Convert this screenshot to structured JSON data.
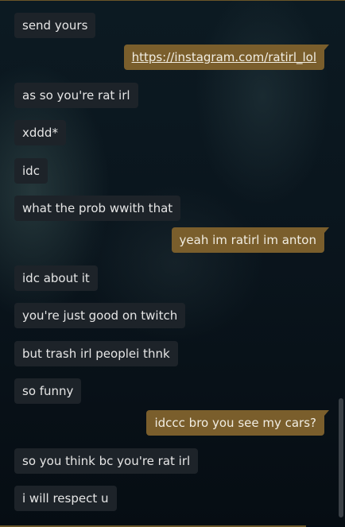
{
  "messages": [
    {
      "text": "send yours",
      "direction": "in"
    },
    {
      "text": "https://instagram.com/ratirl_lol",
      "direction": "out",
      "is_link": true
    },
    {
      "text": "as so you're rat irl",
      "direction": "in"
    },
    {
      "text": "xddd*",
      "direction": "in"
    },
    {
      "text": "idc",
      "direction": "in"
    },
    {
      "text": "what the prob wwith that",
      "direction": "in"
    },
    {
      "text": "yeah im ratirl im anton",
      "direction": "out"
    },
    {
      "text": "idc about it",
      "direction": "in"
    },
    {
      "text": "you're just good on twitch",
      "direction": "in"
    },
    {
      "text": "but trash irl peoplei thnk",
      "direction": "in"
    },
    {
      "text": "so funny",
      "direction": "in"
    },
    {
      "text": "idccc bro you see my cars?",
      "direction": "out"
    },
    {
      "text": "so you think bc you're rat irl",
      "direction": "in"
    },
    {
      "text": "i will respect u",
      "direction": "in"
    }
  ],
  "colors": {
    "incoming_bubble": "#1d2329",
    "outgoing_bubble": "#7a5e2c",
    "accent_border": "#6b5628",
    "background": "#071018"
  }
}
